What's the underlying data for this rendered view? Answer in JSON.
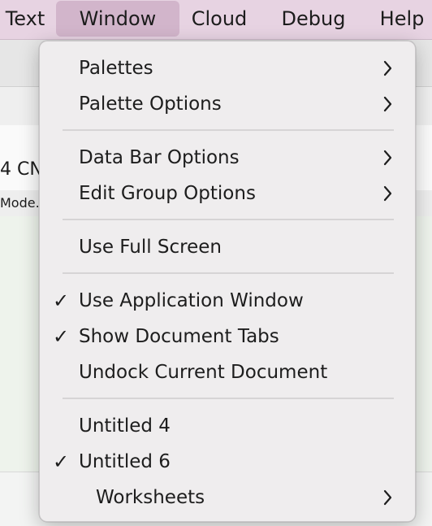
{
  "menubar": {
    "items": [
      "Text",
      "Window",
      "Cloud",
      "Debug",
      "Help"
    ]
  },
  "background": {
    "fragment1": "4  CN",
    "fragment2": "Mode."
  },
  "window_menu": {
    "items": [
      {
        "label": "Palettes",
        "submenu": true,
        "checked": false
      },
      {
        "label": "Palette Options",
        "submenu": true,
        "checked": false
      },
      {
        "label": "Data Bar Options",
        "submenu": true,
        "checked": false
      },
      {
        "label": "Edit Group Options",
        "submenu": true,
        "checked": false
      },
      {
        "label": "Use Full Screen",
        "submenu": false,
        "checked": false
      },
      {
        "label": "Use Application Window",
        "submenu": false,
        "checked": true
      },
      {
        "label": "Show Document Tabs",
        "submenu": false,
        "checked": true
      },
      {
        "label": "Undock Current Document",
        "submenu": false,
        "checked": false
      },
      {
        "label": "Untitled 4",
        "submenu": false,
        "checked": false
      },
      {
        "label": "Untitled 6",
        "submenu": false,
        "checked": true
      },
      {
        "label": "Worksheets",
        "submenu": true,
        "checked": false
      }
    ],
    "check_glyph": "✓"
  },
  "colors": {
    "menubar_bg": "#e7d3e2",
    "menubar_active": "#d2b5cb",
    "menu_bg": "#efedee"
  }
}
